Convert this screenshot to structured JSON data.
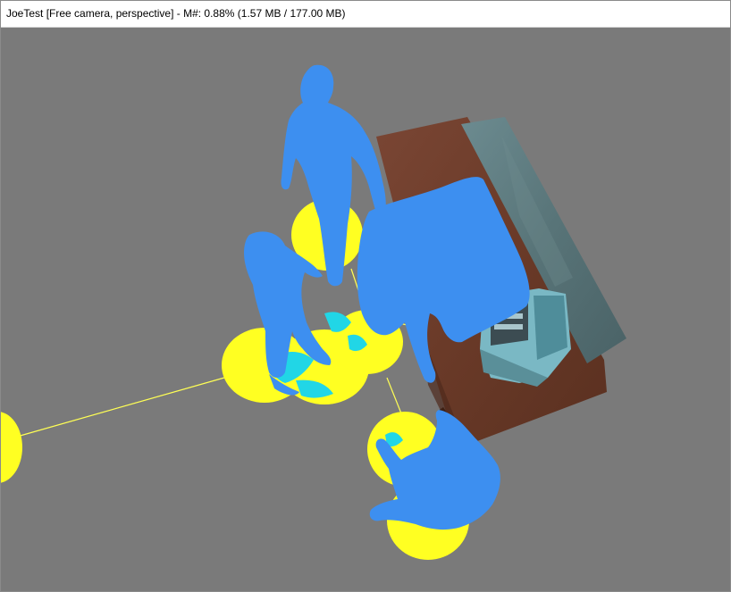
{
  "window": {
    "title": "JoeTest [Free camera, perspective] - M#: 0.88% (1.57 MB / 177.00 MB)"
  },
  "scene": {
    "background_color": "#7a7a7a",
    "figure_color": "#3d8ff0",
    "selection_color": "#ffff22",
    "overlap_color": "#21d6e6",
    "link_line_color": "#ffff55",
    "table_wood_color": "#6e3e2a",
    "metal_panel_color": "#5f7c82",
    "cash_register_color": "#7ab8c4"
  }
}
